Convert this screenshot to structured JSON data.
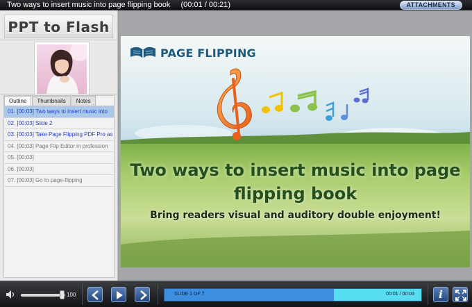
{
  "titlebar": {
    "title": "Two ways to insert music into page flipping book",
    "time": "(00:01 / 00:21)",
    "attachments_label": "ATTACHMENTS"
  },
  "sidebar": {
    "logo_text": "PPT to Flash",
    "tabs": [
      {
        "label": "Outline",
        "active": true
      },
      {
        "label": "Thumbnails",
        "active": false
      },
      {
        "label": "Notes",
        "active": false
      }
    ],
    "outline": [
      {
        "text": "01. [00:03] Two ways to insert music into",
        "state": "selected"
      },
      {
        "text": "02. [00:03] Slide 2",
        "state": "linked"
      },
      {
        "text": "03. [00:03] Take Page Flipping PDF Pro as",
        "state": "linked"
      },
      {
        "text": "04. [00:03] Page Flip Editor in profession",
        "state": "plain"
      },
      {
        "text": "05. [00:03]",
        "state": "plain"
      },
      {
        "text": "06. [00:03]",
        "state": "plain"
      },
      {
        "text": "07. [00:03] Go to page-flipping",
        "state": "plain"
      }
    ]
  },
  "slide": {
    "brand": "PAGE FLIPPING",
    "title": "Two ways to insert music into page flipping book",
    "subtitle": "Bring readers visual and auditory double enjoyment!",
    "icons": [
      "book-icon",
      "music-notes-graphic"
    ]
  },
  "controls": {
    "volume_value": "100",
    "volume_fraction": 0.92,
    "slide_counter": "SLIDE 1 OF 7",
    "timecode": "00:01 / 00:03",
    "progress_fraction": 0.66,
    "info_label": "i",
    "icons": [
      "speaker-icon",
      "prev-icon",
      "play-icon",
      "next-icon",
      "info-icon",
      "fullscreen-icon"
    ]
  },
  "colors": {
    "selected_row": "#a9c8ea",
    "link_text": "#2a3fd6",
    "progress_fill": "#3b8ee0",
    "progress_track": "#56ddef",
    "slide_title": "#25501e"
  }
}
